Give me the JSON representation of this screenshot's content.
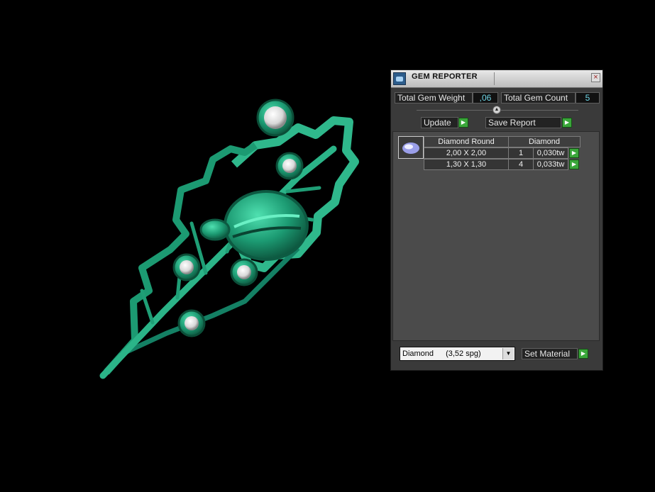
{
  "panel": {
    "title": "GEM REPORTER",
    "close_icon": "close-icon",
    "app_icon": "gem-reporter-icon"
  },
  "summary": {
    "weight_label": "Total Gem Weight",
    "weight_value": ",06",
    "count_label": "Total Gem Count",
    "count_value": "5"
  },
  "buttons": {
    "update": "Update",
    "save_report": "Save Report",
    "set_material": "Set Material"
  },
  "table": {
    "headers": [
      "Diamond Round",
      "Diamond"
    ],
    "rows": [
      {
        "size": "2,00 X 2,00",
        "count": "1",
        "weight": "0,030tw"
      },
      {
        "size": "1,30 X 1,30",
        "count": "4",
        "weight": "0,033tw"
      }
    ]
  },
  "material": {
    "name": "Diamond",
    "density": "(3,52 spg)"
  },
  "colors": {
    "model": "#1a9a72",
    "accent": "#3aa63a",
    "value_text": "#6fd6e6"
  }
}
